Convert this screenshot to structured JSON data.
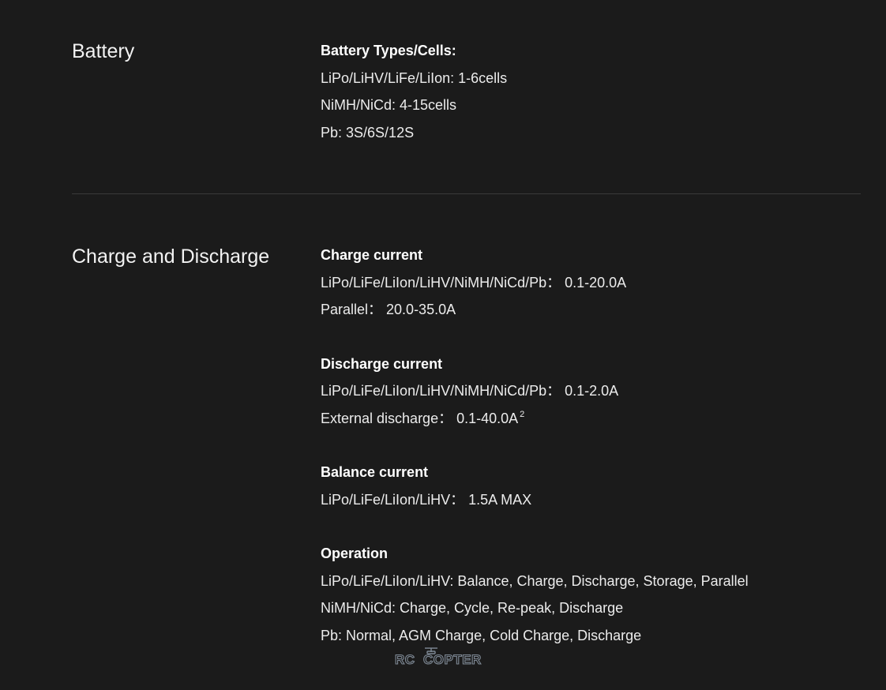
{
  "sections": [
    {
      "title": "Battery",
      "groups": [
        {
          "heading": "Battery Types/Cells:",
          "lines": [
            "LiPo/LiHV/LiFe/LiIon: 1-6cells",
            "NiMH/NiCd: 4-15cells",
            "Pb: 3S/6S/12S"
          ]
        }
      ]
    },
    {
      "title": "Charge and Discharge",
      "groups": [
        {
          "heading": "Charge current",
          "lines": [
            "LiPo/LiFe/LiIon/LiHV/NiMH/NiCd/Pb： 0.1-20.0A",
            "Parallel： 20.0-35.0A"
          ]
        },
        {
          "heading": "Discharge current",
          "lines": [
            "LiPo/LiFe/LiIon/LiHV/NiMH/NiCd/Pb： 0.1-2.0A",
            "External discharge： 0.1-40.0A"
          ],
          "footnote": "2"
        },
        {
          "heading": "Balance current",
          "lines": [
            "LiPo/LiFe/LiIon/LiHV： 1.5A MAX"
          ]
        },
        {
          "heading": "Operation",
          "lines": [
            "LiPo/LiFe/LiIon/LiHV: Balance, Charge, Discharge, Storage, Parallel",
            "NiMH/NiCd: Charge, Cycle, Re-peak, Discharge",
            "Pb: Normal, AGM Charge, Cold Charge, Discharge"
          ]
        }
      ]
    }
  ],
  "watermark": {
    "text_left": "RC",
    "text_right": "COPTER",
    "color": "#7f8a96"
  },
  "colors": {
    "background": "#1b1b1b",
    "text": "#ffffff",
    "divider": "#3a3a3a"
  }
}
